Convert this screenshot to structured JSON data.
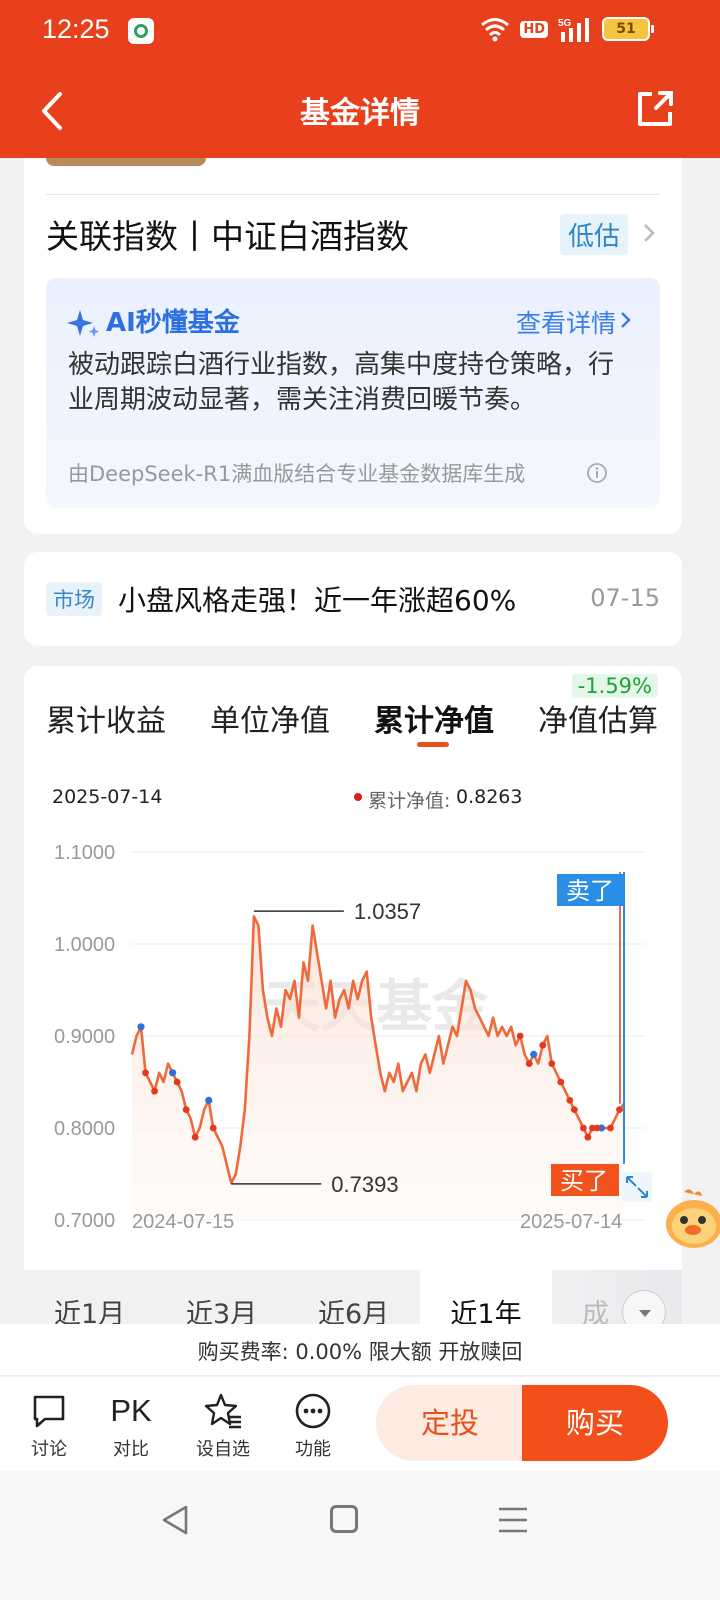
{
  "status": {
    "time": "12:25",
    "hd": "HD",
    "network": "5G",
    "battery": "51"
  },
  "header": {
    "title": "基金详情"
  },
  "index_card": {
    "title": "关联指数丨中证白酒指数",
    "valuation": "低估",
    "ai": {
      "title": "AI秒懂基金",
      "detail_link": "查看详情",
      "body": "被动跟踪白酒行业指数，高集中度持仓策略，行业周期波动显著，需关注消费回暖节奏。",
      "source": "由DeepSeek-R1满血版结合专业基金数据库生成"
    }
  },
  "news": {
    "tag": "市场",
    "title": "小盘风格走强！近一年涨超60%",
    "date": "07-15"
  },
  "chart_tabs": [
    "累计收益",
    "单位净值",
    "累计净值",
    "净值估算"
  ],
  "active_tab": "累计净值",
  "estimate_change": "-1.59%",
  "tooltip": {
    "date": "2025-07-14",
    "label": "累计净值:",
    "value": "0.8263"
  },
  "chart_data": {
    "type": "line",
    "ylim": [
      0.7,
      1.1
    ],
    "y_ticks": [
      "1.1000",
      "1.0000",
      "0.9000",
      "0.8000",
      "0.7000"
    ],
    "x_tick_labels": [
      "2024-07-15",
      "2025-07-14"
    ],
    "watermark": "天天基金",
    "max_label": "1.0357",
    "min_label": "0.7393",
    "sell_label": "卖了",
    "buy_label": "买了",
    "series": [
      {
        "values": [
          0.88,
          0.9,
          0.91,
          0.86,
          0.85,
          0.84,
          0.86,
          0.85,
          0.87,
          0.86,
          0.85,
          0.84,
          0.82,
          0.81,
          0.79,
          0.8,
          0.82,
          0.83,
          0.8,
          0.79,
          0.78,
          0.76,
          0.74,
          0.75,
          0.78,
          0.82,
          0.9,
          1.03,
          1.02,
          0.95,
          0.92,
          0.9,
          0.93,
          0.91,
          0.95,
          0.94,
          0.96,
          0.92,
          0.98,
          0.96,
          1.02,
          0.99,
          0.96,
          0.93,
          0.96,
          0.92,
          0.94,
          0.95,
          0.93,
          0.96,
          0.94,
          0.96,
          0.97,
          0.92,
          0.89,
          0.86,
          0.84,
          0.86,
          0.85,
          0.87,
          0.84,
          0.85,
          0.86,
          0.84,
          0.87,
          0.88,
          0.86,
          0.88,
          0.9,
          0.87,
          0.89,
          0.91,
          0.9,
          0.93,
          0.96,
          0.95,
          0.93,
          0.92,
          0.91,
          0.9,
          0.92,
          0.9,
          0.91,
          0.9,
          0.91,
          0.89,
          0.9,
          0.88,
          0.87,
          0.88,
          0.87,
          0.89,
          0.9,
          0.87,
          0.86,
          0.85,
          0.84,
          0.83,
          0.82,
          0.81,
          0.8,
          0.79,
          0.8,
          0.8,
          0.8,
          0.8,
          0.8,
          0.81,
          0.82,
          0.8263
        ]
      }
    ]
  },
  "periods": [
    "近1月",
    "近3月",
    "近6月",
    "近1年",
    "成"
  ],
  "active_period": "近1年",
  "fee_text": "购买费率: 0.00% 限大额 开放赎回",
  "actions": [
    {
      "label": "讨论",
      "icon": "chat-icon"
    },
    {
      "label": "对比",
      "icon": "pk-icon",
      "glyph": "PK"
    },
    {
      "label": "设自选",
      "icon": "star-list-icon"
    },
    {
      "label": "功能",
      "icon": "more-icon"
    }
  ],
  "buttons": {
    "dingtou": "定投",
    "buy": "购买"
  },
  "colors": {
    "brand": "#e8401c",
    "line": "#ee6a3c",
    "up_green": "#1da33a",
    "ai_blue": "#2d6ee0"
  }
}
